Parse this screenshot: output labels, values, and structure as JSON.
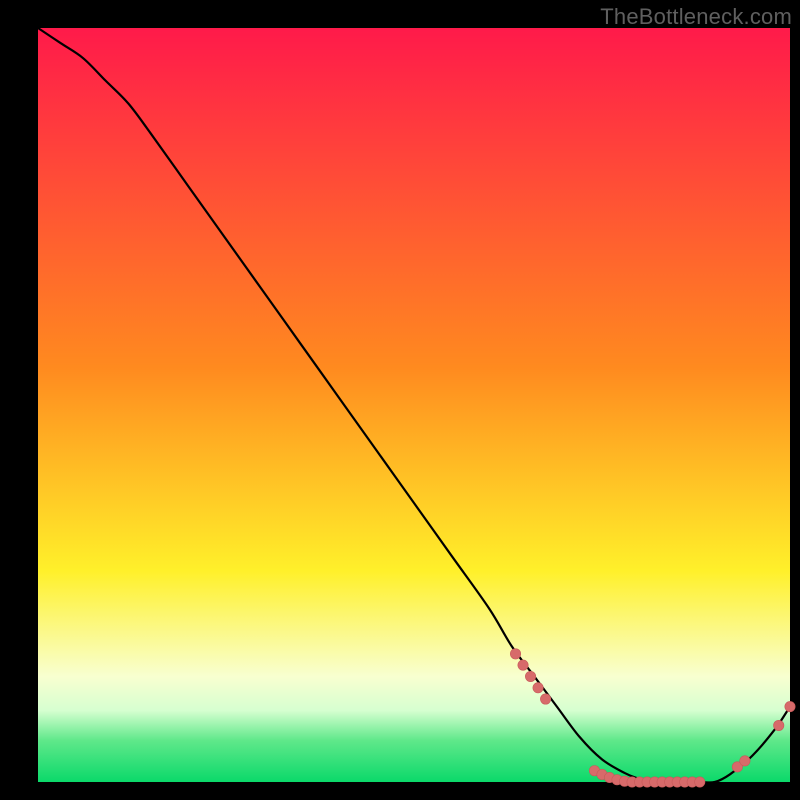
{
  "watermark": "TheBottleneck.com",
  "colors": {
    "background": "#000000",
    "watermark_text": "#5f5f5f",
    "curve": "#000000",
    "marker_fill": "#d76a6a",
    "marker_stroke": "#c75a5a",
    "gradient_top": "#ff1a4a",
    "gradient_mid_orange": "#ff8a1f",
    "gradient_yellow": "#fff02a",
    "gradient_pale_yellow": "#f8ffc8",
    "gradient_green": "#0bd96a"
  },
  "chart_data": {
    "type": "line",
    "title": "",
    "xlabel": "",
    "ylabel": "",
    "xlim": [
      0,
      100
    ],
    "ylim": [
      0,
      100
    ],
    "grid": false,
    "legend": false,
    "background_gradient_stops": [
      {
        "offset": 0.0,
        "color": "#ff1a4a"
      },
      {
        "offset": 0.45,
        "color": "#ff8a1f"
      },
      {
        "offset": 0.72,
        "color": "#fff02a"
      },
      {
        "offset": 0.86,
        "color": "#f8ffd0"
      },
      {
        "offset": 0.905,
        "color": "#d6ffd0"
      },
      {
        "offset": 0.945,
        "color": "#5fe88a"
      },
      {
        "offset": 1.0,
        "color": "#0bd96a"
      }
    ],
    "series": [
      {
        "name": "bottleneck-curve",
        "x": [
          0,
          3,
          6,
          9,
          12,
          15,
          20,
          25,
          30,
          35,
          40,
          45,
          50,
          55,
          60,
          63,
          66,
          69,
          72,
          75,
          78,
          80,
          82,
          85,
          88,
          90,
          92,
          95,
          98,
          100
        ],
        "y": [
          100,
          98,
          96,
          93,
          90,
          86,
          79,
          72,
          65,
          58,
          51,
          44,
          37,
          30,
          23,
          18,
          14,
          10,
          6,
          3,
          1.2,
          0.4,
          0,
          0,
          0,
          0,
          1,
          3.5,
          7,
          10
        ]
      }
    ],
    "markers": [
      {
        "series": "bottleneck-curve",
        "x": 63.5,
        "y": 17
      },
      {
        "series": "bottleneck-curve",
        "x": 64.5,
        "y": 15.5
      },
      {
        "series": "bottleneck-curve",
        "x": 65.5,
        "y": 14
      },
      {
        "series": "bottleneck-curve",
        "x": 66.5,
        "y": 12.5
      },
      {
        "series": "bottleneck-curve",
        "x": 67.5,
        "y": 11
      },
      {
        "series": "bottleneck-curve",
        "x": 74.0,
        "y": 1.5
      },
      {
        "series": "bottleneck-curve",
        "x": 75.0,
        "y": 1.0
      },
      {
        "series": "bottleneck-curve",
        "x": 76.0,
        "y": 0.6
      },
      {
        "series": "bottleneck-curve",
        "x": 77.0,
        "y": 0.3
      },
      {
        "series": "bottleneck-curve",
        "x": 78.0,
        "y": 0.1
      },
      {
        "series": "bottleneck-curve",
        "x": 79.0,
        "y": 0
      },
      {
        "series": "bottleneck-curve",
        "x": 80.0,
        "y": 0
      },
      {
        "series": "bottleneck-curve",
        "x": 81.0,
        "y": 0
      },
      {
        "series": "bottleneck-curve",
        "x": 82.0,
        "y": 0
      },
      {
        "series": "bottleneck-curve",
        "x": 83.0,
        "y": 0
      },
      {
        "series": "bottleneck-curve",
        "x": 84.0,
        "y": 0
      },
      {
        "series": "bottleneck-curve",
        "x": 85.0,
        "y": 0
      },
      {
        "series": "bottleneck-curve",
        "x": 86.0,
        "y": 0
      },
      {
        "series": "bottleneck-curve",
        "x": 87.0,
        "y": 0
      },
      {
        "series": "bottleneck-curve",
        "x": 88.0,
        "y": 0
      },
      {
        "series": "bottleneck-curve",
        "x": 93.0,
        "y": 2.0
      },
      {
        "series": "bottleneck-curve",
        "x": 94.0,
        "y": 2.8
      },
      {
        "series": "bottleneck-curve",
        "x": 98.5,
        "y": 7.5
      },
      {
        "series": "bottleneck-curve",
        "x": 100.0,
        "y": 10
      }
    ]
  }
}
